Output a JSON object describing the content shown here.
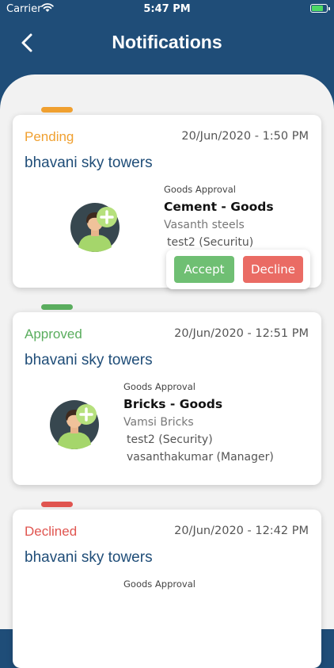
{
  "status_bar": {
    "carrier": "Carrier",
    "time": "5:47 PM"
  },
  "header": {
    "title": "Notifications"
  },
  "colors": {
    "pending": "#f0a030",
    "approved": "#5aad5e",
    "declined": "#e05550",
    "header_bg": "#1f4d78"
  },
  "icons": {
    "back": "chevron-left-icon",
    "avatar": "user-add-avatar-icon"
  },
  "notifications": [
    {
      "status": "Pending",
      "timestamp": "20/Jun/2020 - 1:50 PM",
      "site": "bhavani sky towers",
      "approval_type": "Goods Approval",
      "item": "Cement - Goods",
      "supplier": "Vasanth steels",
      "people": [
        "test2 (Securitu)"
      ],
      "actions": {
        "accept": "Accept",
        "decline": "Decline"
      }
    },
    {
      "status": "Approved",
      "timestamp": "20/Jun/2020 - 12:51 PM",
      "site": "bhavani sky towers",
      "approval_type": "Goods Approval",
      "item": "Bricks - Goods",
      "supplier": "Vamsi Bricks",
      "people": [
        "test2 (Security)",
        "vasanthakumar (Manager)"
      ]
    },
    {
      "status": "Declined",
      "timestamp": "20/Jun/2020 - 12:42 PM",
      "site": "bhavani sky towers",
      "approval_type": "Goods Approval"
    }
  ]
}
